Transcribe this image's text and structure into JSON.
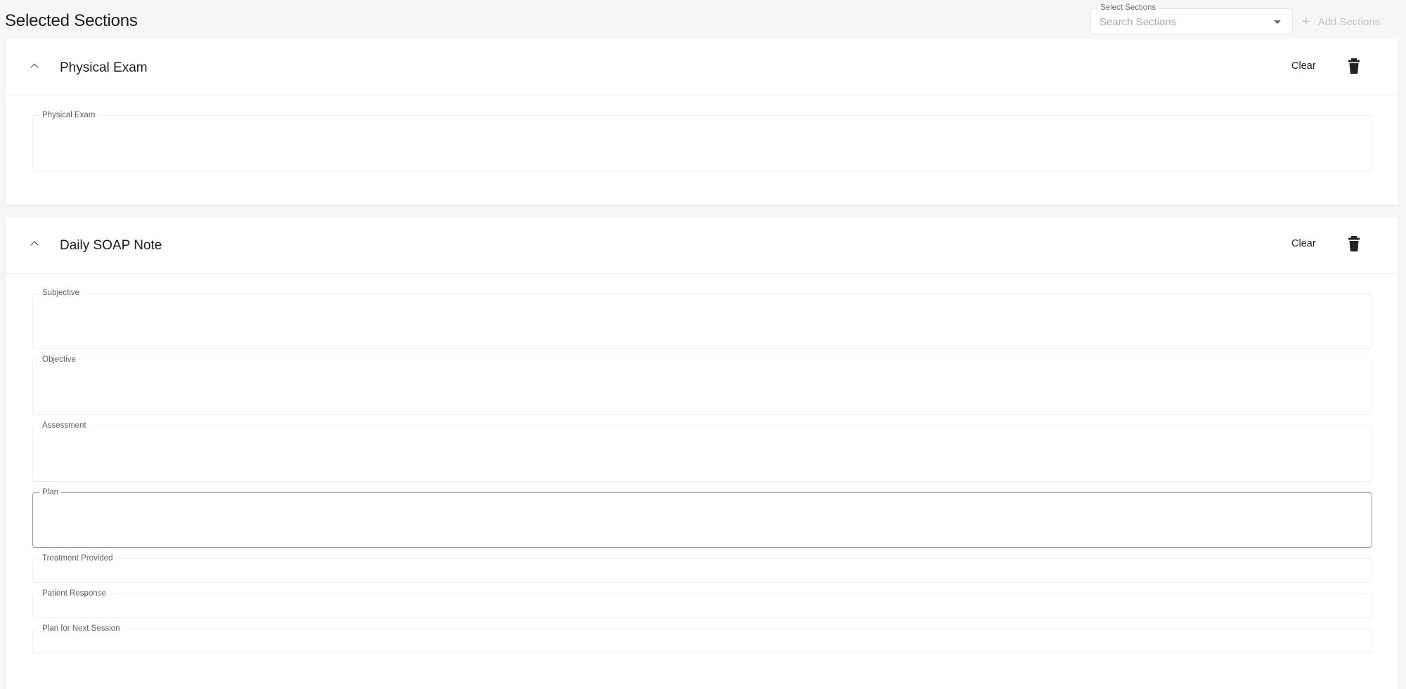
{
  "page": {
    "title": "Selected Sections"
  },
  "section_select": {
    "label": "Select Sections",
    "placeholder": "Search Sections"
  },
  "add_sections": {
    "label": "Add Sections"
  },
  "cards": [
    {
      "title": "Physical Exam",
      "clear_label": "Clear",
      "fields": [
        {
          "label": "Physical Exam"
        }
      ]
    },
    {
      "title": "Daily SOAP Note",
      "clear_label": "Clear",
      "fields": [
        {
          "label": "Subjective"
        },
        {
          "label": "Objective"
        },
        {
          "label": "Assessment"
        },
        {
          "label": "Plan"
        },
        {
          "label": "Treatment Provided"
        },
        {
          "label": "Patient Response"
        },
        {
          "label": "Plan for Next Session"
        }
      ]
    }
  ]
}
